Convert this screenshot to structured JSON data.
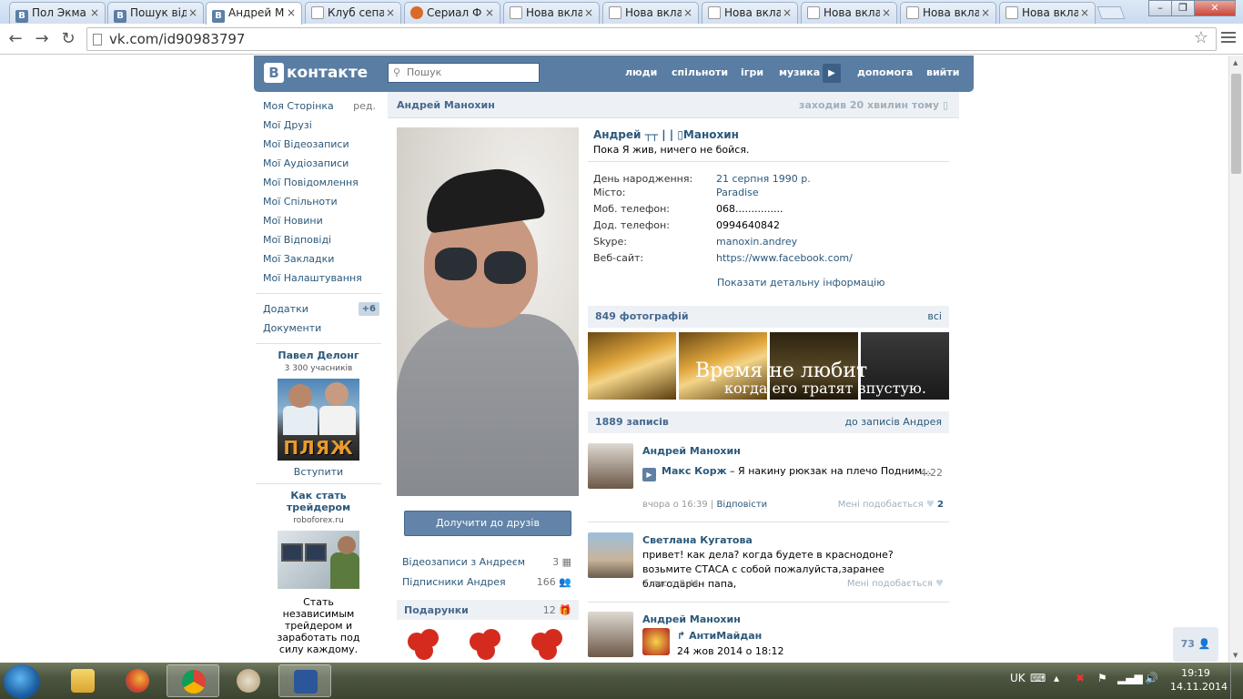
{
  "browser": {
    "tabs": [
      {
        "title": "Пол Экма",
        "icon": "vk-icon"
      },
      {
        "title": "Пошук від",
        "icon": "vk-icon"
      },
      {
        "title": "Андрей М",
        "icon": "vk-icon",
        "active": true
      },
      {
        "title": "Клуб сепа",
        "icon": "page-icon"
      },
      {
        "title": "Сериал Ф",
        "icon": "firefox-fox-icon"
      },
      {
        "title": "Нова вкладка",
        "icon": "page-icon"
      },
      {
        "title": "Нова вкладка",
        "icon": "page-icon"
      },
      {
        "title": "Нова вкладка",
        "icon": "page-icon"
      },
      {
        "title": "Нова вкладка",
        "icon": "page-icon"
      },
      {
        "title": "Нова вкладка",
        "icon": "page-icon"
      },
      {
        "title": "Нова вкладка",
        "icon": "page-icon"
      }
    ],
    "url": "vk.com/id90983797",
    "tab_close_glyph": "×",
    "star_glyph": "☆"
  },
  "header": {
    "logo_letter": "В",
    "logo_text": "контакте",
    "search_placeholder": "Пошук",
    "nav": {
      "people": "люди",
      "communities": "спільноти",
      "games": "ігри",
      "music": "музика",
      "help": "допомога",
      "logout": "вийти"
    }
  },
  "left_menu": {
    "items": [
      "Моя Сторінка",
      "Мої Друзі",
      "Мої Відеозаписи",
      "Мої Аудіозаписи",
      "Мої Повідомлення",
      "Мої Спільноти",
      "Мої Новини",
      "Мої Відповіді",
      "Мої Закладки",
      "Мої Налаштування"
    ],
    "edit_label": "ред.",
    "apps_label": "Додатки",
    "apps_count": "+6",
    "docs_label": "Документи"
  },
  "ads": [
    {
      "title": "Павел Делонг",
      "subtitle": "3 300 учасників",
      "image_word": "ПЛЯЖ",
      "link": "Вступити"
    },
    {
      "title": "Как стать трейдером",
      "subtitle": "roboforex.ru",
      "text": "Стать независимым трейдером и заработать под силу каждому."
    }
  ],
  "profile": {
    "bar_name": "Андрей Манохин",
    "bar_status": "заходив 20 хвилин тому",
    "full_name": "Андрей ┬┬ | | ▯Манохин",
    "motto": "Пока Я жив, ничего не бойся.",
    "add_friend": "Долучити до друзів",
    "videos_label": "Відеозаписи з Андреєм",
    "videos_count": "3",
    "followers_label": "Підписники Андрея",
    "followers_count": "166",
    "gifts_label": "Подарунки",
    "gifts_count": "12",
    "info": [
      {
        "key": "День народження:",
        "value": "21 серпня 1990 р.",
        "link": true
      },
      {
        "key": "Місто:",
        "value": "Paradise",
        "link": true
      },
      {
        "key": "Моб. телефон:",
        "value": "068...............",
        "link": false
      },
      {
        "key": "Дод. телефон:",
        "value": "0994640842",
        "link": false
      },
      {
        "key": "Skype:",
        "value": "manoxin.andrey",
        "link": true
      },
      {
        "key": "Веб-сайт:",
        "value": "https://www.facebook.com/",
        "link": true
      }
    ],
    "details_link": "Показати детальну інформацію",
    "photos_label": "849 фотографій",
    "photos_all": "всі",
    "photo_caption_1": "Время не любит",
    "photo_caption_2": "когда его тратят впустую.",
    "posts_label": "1889 записів",
    "posts_link": "до записів Андрея"
  },
  "posts": [
    {
      "author": "Андрей Манохин",
      "audio_artist": "Макс Корж",
      "audio_title": " – Я накину рюкзак на плечо Подним...",
      "audio_time": "4:22",
      "time": "вчора о 16:39",
      "reply": "Відповісти",
      "like_label": "Мені подобається",
      "like_count": "2"
    },
    {
      "author": "Светлана Кугатова",
      "text": "привет! как дела? когда будете в краснодоне? возьмите СТАСА с собой пожалуйста,заранее благодарен папа,",
      "time": "1 лис о 8:41",
      "like_label": "Мені подобається"
    },
    {
      "author": "Андрей Манохин",
      "repost_title": "АнтиМайдан",
      "repost_time": "24 жов 2014 о 18:12"
    }
  ],
  "online_count": "73",
  "taskbar": {
    "apps": [
      "explorer-icon",
      "firefox-icon",
      "chrome-icon",
      "paint-icon",
      "word-icon"
    ],
    "lang": "UK",
    "time": "19:19",
    "date": "14.11.2014"
  },
  "colors": {
    "vk_blue": "#597da3",
    "link": "#2b587a",
    "bar": "#edf1f5"
  }
}
